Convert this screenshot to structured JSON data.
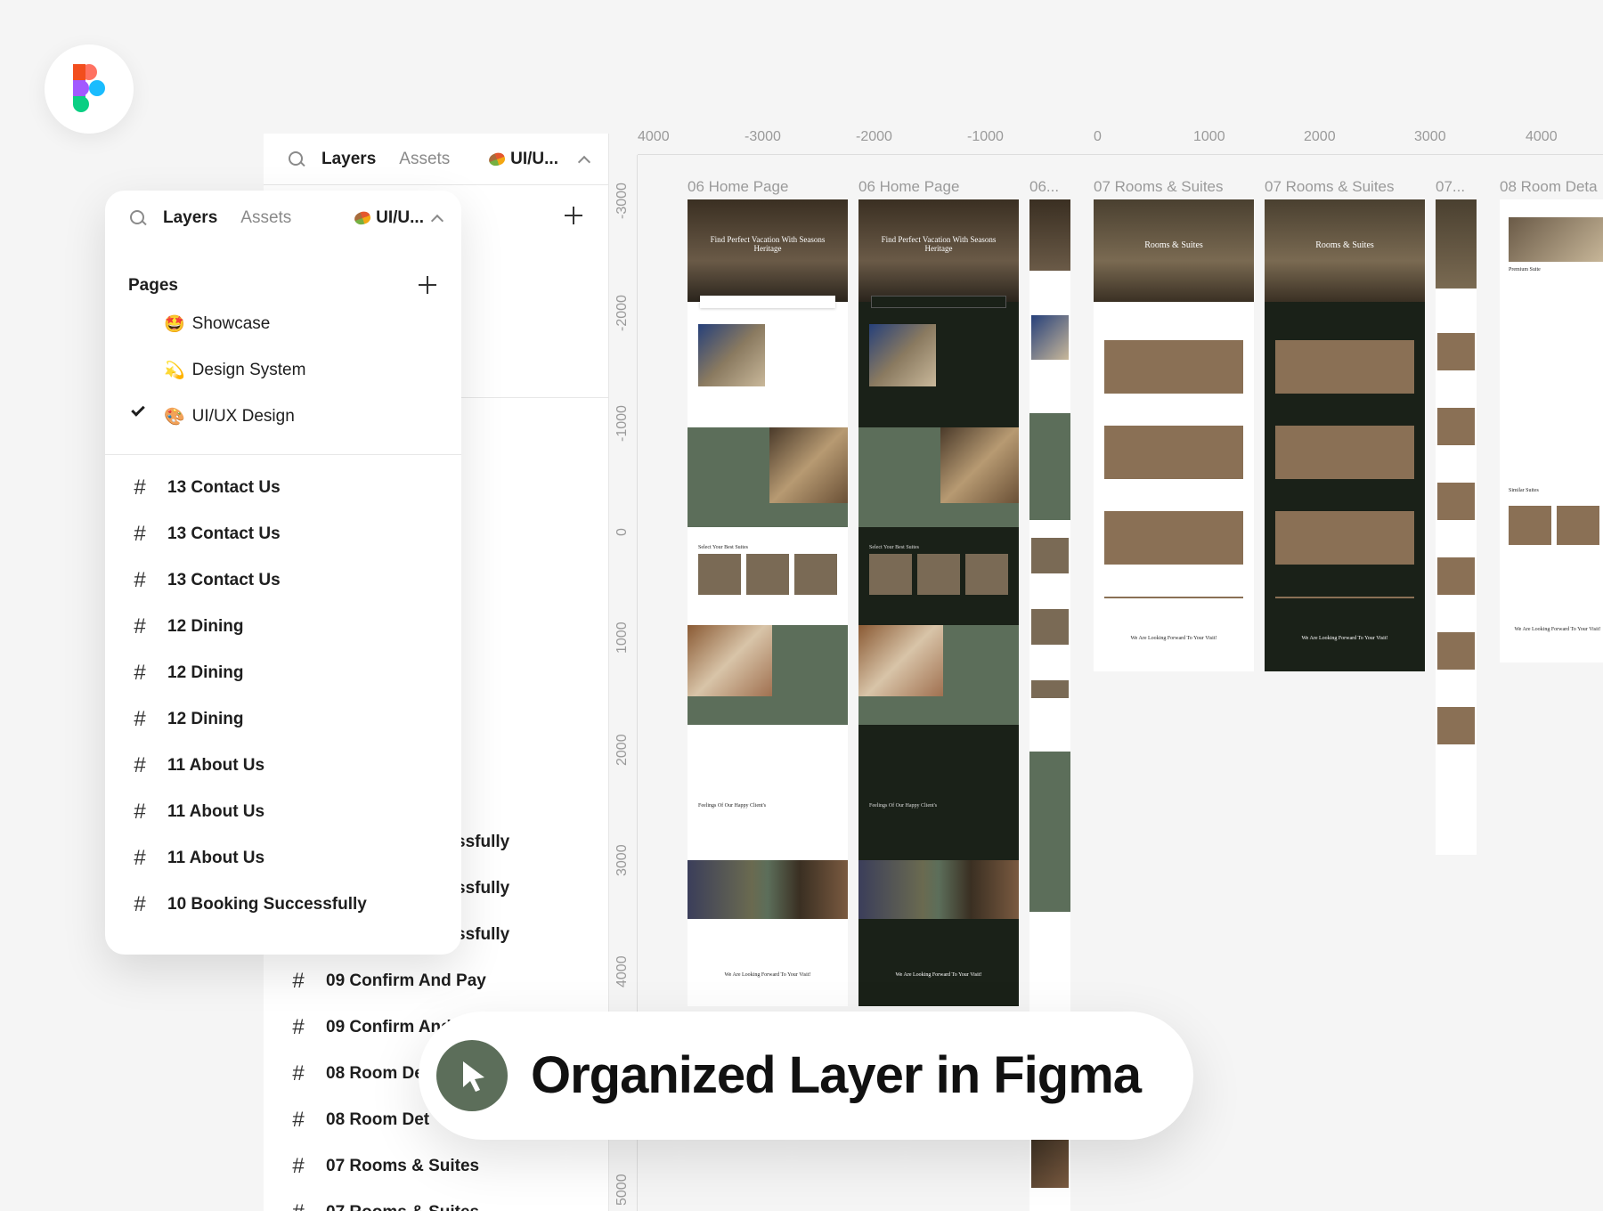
{
  "back_panel": {
    "tabs": {
      "layers": "Layers",
      "assets": "Assets"
    },
    "current_page": "UI/U...",
    "layers": [
      {
        "label": "ssfully"
      },
      {
        "label": "ssfully"
      },
      {
        "label": "ssfully"
      },
      {
        "label": "09 Confirm And Pay"
      },
      {
        "label": "09 Confirm And Pay"
      },
      {
        "label": "08 Room De"
      },
      {
        "label": "08 Room Det"
      },
      {
        "label": "07 Rooms & Suites"
      },
      {
        "label": "07 Rooms & Suites"
      }
    ]
  },
  "front_panel": {
    "tabs": {
      "layers": "Layers",
      "assets": "Assets"
    },
    "current_page": "UI/U...",
    "pages_title": "Pages",
    "pages": [
      {
        "emoji": "🤩",
        "label": "Showcase",
        "selected": false
      },
      {
        "emoji": "💫",
        "label": "Design System",
        "selected": false
      },
      {
        "emoji": "🎨",
        "label": "UI/UX Design",
        "selected": true
      }
    ],
    "layers": [
      {
        "label": "13 Contact Us"
      },
      {
        "label": "13 Contact Us"
      },
      {
        "label": "13 Contact Us"
      },
      {
        "label": "12 Dining"
      },
      {
        "label": "12 Dining"
      },
      {
        "label": "12 Dining"
      },
      {
        "label": "11 About Us"
      },
      {
        "label": "11 About Us"
      },
      {
        "label": "11 About Us"
      },
      {
        "label": "10 Booking Successfully"
      }
    ]
  },
  "rulers": {
    "x_ticks": [
      "4000",
      "-3000",
      "-2000",
      "-1000",
      "0",
      "1000",
      "2000",
      "3000",
      "4000"
    ],
    "y_ticks": [
      "-3000",
      "-2000",
      "-1000",
      "0",
      "1000",
      "2000",
      "3000",
      "4000",
      "5000"
    ]
  },
  "frames": [
    {
      "title": "06 Home Page",
      "theme": "light"
    },
    {
      "title": "06 Home Page",
      "theme": "dark"
    },
    {
      "title": "06...",
      "theme": "mobile"
    },
    {
      "title": "07 Rooms & Suites",
      "theme": "light"
    },
    {
      "title": "07 Rooms & Suites",
      "theme": "dark"
    },
    {
      "title": "07...",
      "theme": "mobile"
    },
    {
      "title": "08 Room Deta",
      "theme": "light"
    }
  ],
  "frame_text": {
    "hero_heading": "Find Perfect Vacation With Seasons Heritage",
    "rooms_hero": "Rooms & Suites",
    "section_suites": "Select Your Best Suites",
    "section_feelings": "Feelings Of Our Happy Client's",
    "footer_heading": "We Are Looking Forward To Your Visit!",
    "room_title": "Premium Suite",
    "similar": "Similar Suites"
  },
  "caption": "Organized Layer in Figma",
  "colors": {
    "accent": "#5c6e5a",
    "dark_frame": "#1a2118",
    "panel_bg": "#ffffff",
    "canvas_bg": "#f5f5f5"
  }
}
